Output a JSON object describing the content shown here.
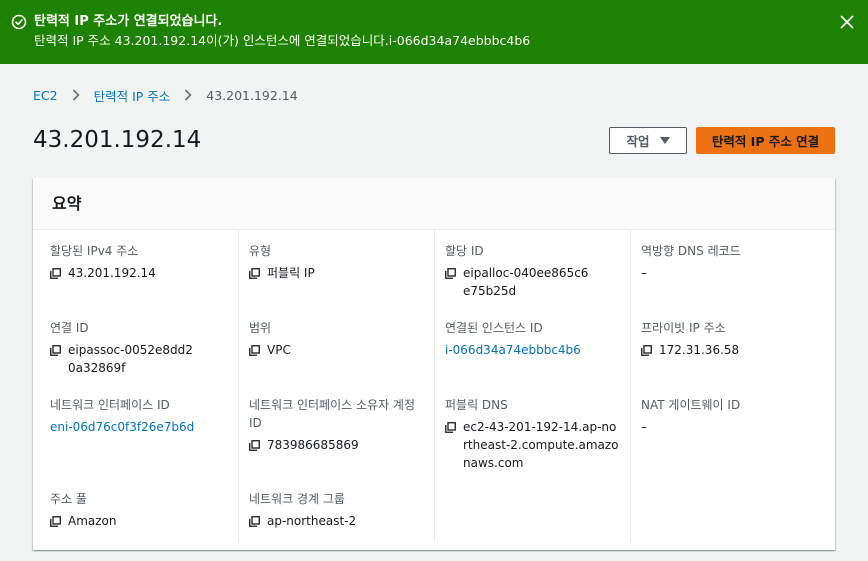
{
  "flash": {
    "title": "탄력적 IP 주소가 연결되었습니다.",
    "message": "탄력적 IP 주소 43.201.192.14이(가) 인스턴스에 연결되었습니다.i-066d34a74ebbbc4b6",
    "color": "#1d8102"
  },
  "breadcrumb": {
    "root": "EC2",
    "section": "탄력적 IP 주소",
    "current": "43.201.192.14"
  },
  "header": {
    "title": "43.201.192.14",
    "actions_label": "작업",
    "primary_label": "탄력적 IP 주소 연결",
    "primary_color": "#ec7211"
  },
  "summary": {
    "title": "요약",
    "fields": {
      "ipv4": {
        "label": "할당된 IPv4 주소",
        "value": "43.201.192.14"
      },
      "type": {
        "label": "유형",
        "value": "퍼블릭 IP"
      },
      "allocation_id": {
        "label": "할당 ID",
        "value": "eipalloc-040ee865c6e75b25d"
      },
      "reverse_dns": {
        "label": "역방향 DNS 레코드",
        "value": "–"
      },
      "association_id": {
        "label": "연결 ID",
        "value": "eipassoc-0052e8dd20a32869f"
      },
      "scope": {
        "label": "범위",
        "value": "VPC"
      },
      "instance_id": {
        "label": "연결된 인스턴스 ID",
        "value": "i-066d34a74ebbbc4b6"
      },
      "private_ip": {
        "label": "프라이빗 IP 주소",
        "value": "172.31.36.58"
      },
      "eni_id": {
        "label": "네트워크 인터페이스 ID",
        "value": "eni-06d76c0f3f26e7b6d"
      },
      "eni_owner": {
        "label": "네트워크 인터페이스 소유자 계정 ID",
        "value": "783986685869"
      },
      "public_dns": {
        "label": "퍼블릭 DNS",
        "value": "ec2-43-201-192-14.ap-northeast-2.compute.amazonaws.com"
      },
      "nat_gateway": {
        "label": "NAT 게이트웨이 ID",
        "value": "–"
      },
      "pool": {
        "label": "주소 풀",
        "value": "Amazon"
      },
      "border_group": {
        "label": "네트워크 경계 그룹",
        "value": "ap-northeast-2"
      }
    }
  },
  "icons": {
    "flash": "check-circle-icon",
    "close": "close-icon",
    "copy": "copy-icon",
    "separator": "chevron-right-icon",
    "dropdown": "caret-down-icon"
  }
}
